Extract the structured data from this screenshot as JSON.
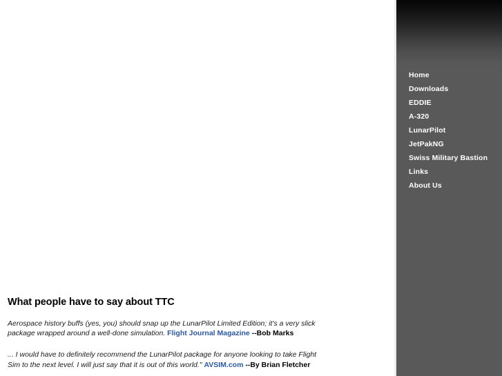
{
  "page": {
    "background_color": "#ffffff",
    "sidebar_color": "#595959",
    "link_color": "#2a58a8"
  },
  "sidebar": {
    "nav_items": [
      {
        "label": "Home"
      },
      {
        "label": "Downloads"
      },
      {
        "label": "EDDIE"
      },
      {
        "label": "A-320"
      },
      {
        "label": "LunarPilot"
      },
      {
        "label": "JetPakNG"
      },
      {
        "label": "Swiss Military Bastion"
      },
      {
        "label": "Links"
      },
      {
        "label": "About Us"
      }
    ]
  },
  "main": {
    "section_title": "What people have to say about TTC",
    "testimonials": [
      {
        "quote": "Aerospace history buffs (yes, you) should snap up the LunarPilot Limited Edition; it's a very slick package wrapped around a well-done simulation. ",
        "source_link": "Flight Journal Magazine",
        "byline": " --Bob Marks"
      },
      {
        "quote": "... I would have to definitely recommend the LunarPilot package for anyone looking to take Flight Sim to the next level. I will just say that it is out of this world.\" ",
        "source_link": "AVSIM.com",
        "byline": " --By Brian Fletcher"
      }
    ]
  }
}
